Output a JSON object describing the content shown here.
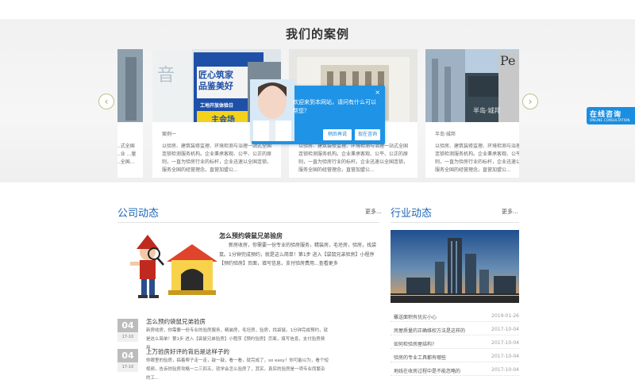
{
  "cases": {
    "title": "我们的案例",
    "prev_arrow": "‹",
    "next_arrow": "›",
    "cards": [
      {
        "caption": "",
        "desc": "...式全国\n...业\n...量\n...全国..."
      },
      {
        "caption": "案例一",
        "desc": "以验房、建筑装修监理、环境检测与治理一站式全国连锁检测服务机构。企业秉承客观、公平、公正的原则，一直为验房行业的标杆，企业迅速以全国连锁，服务全国的经营理念，直营加盟公..."
      },
      {
        "caption": "",
        "desc": "以验房、建筑装修监理、环境检测与治理一站式全国连锁检测服务机构。企业秉承客观、公平、公正的原则，一直为验房行业的标杆。企业迅速以全国连锁，服务全国的经营理念，直营加盟公..."
      },
      {
        "caption": "半岛·城邦",
        "desc": "以验房、建筑装修监理、环境检测与治理一站式全国连锁检测服务机构。企业秉承客观、公平、公正的原则，一直为验房行业的标杆，企业迅速以全国连锁，服务全国的经营理念，直营加盟公..."
      }
    ],
    "card2_sign": [
      "匠心筑家",
      "品鉴美好",
      "工地开放体验日",
      "主会场"
    ]
  },
  "dialog": {
    "message": "欢迎来到本网站，请问有什么可以帮您？",
    "close": "×",
    "later_button": "稍后再说",
    "consult_button": "现在咨询"
  },
  "consult_badge": {
    "cn": "在线咨询",
    "en": "ONLINE CONSULTATION"
  },
  "company_news": {
    "title": "公司动态",
    "more": "更多...",
    "highlight": {
      "title": "怎么预约袋鼠兄弟验房",
      "text": "新房收房，你需要一份专业的验房服务，精装房，毛坯房，验房，找袋鼠。1分钟完成预约，就是这么简单！第1步 进入【袋鼠兄弟验房】小程序【预约验房】页面，填写信息，支付验房费用...查看更多"
    },
    "items": [
      {
        "day": "04",
        "month": "17-10",
        "title": "怎么预约袋鼠兄弟验房",
        "text": "新房收房，你需要一份专业的验房服务，精装房，毛坯房，验房，找袋鼠。1分钟完成预约，就是这么简单！第1步 进入【袋鼠兄弟验房】小程序【预约验房】页面，填写信息，支付验房费用..."
      },
      {
        "day": "04",
        "month": "17-10",
        "title": "上万验房好评的背后是这样子的",
        "text": "你眼里的验房，搞着帮子走一走，敲一敲，看一看，就完成了，so easy！你可能以为，看个短视频，告诉你验房攻略一二三四五，就学会怎么验房了，其实，真实的验房是一项专业而繁杂的工..."
      }
    ]
  },
  "industry_news": {
    "title": "行业动态",
    "more": "更多...",
    "items": [
      {
        "title": "雕送面积有优劣小心",
        "date": "2019-01-26"
      },
      {
        "title": "房屋质量的正确维权方法是这样的",
        "date": "2017-10-04"
      },
      {
        "title": "如何检验房屋结构?",
        "date": "2017-10-04"
      },
      {
        "title": "验房的专业工具都有哪些",
        "date": "2017-10-04"
      },
      {
        "title": "地线在收房过程中是不能忽略的",
        "date": "2017-10-04"
      }
    ]
  }
}
